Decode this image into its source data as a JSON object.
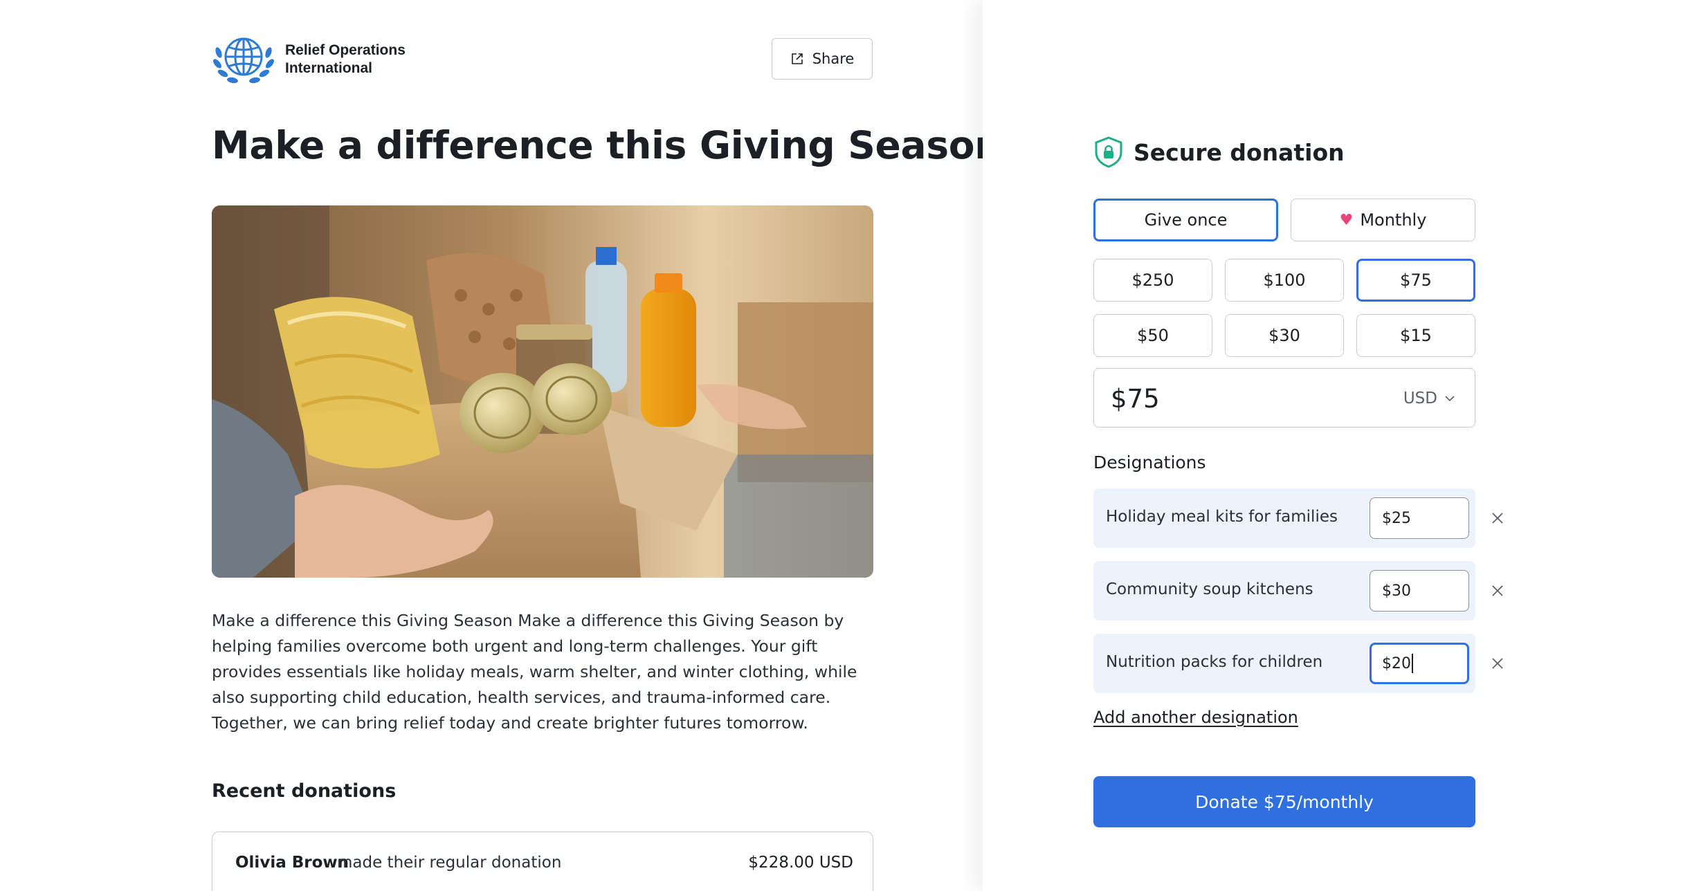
{
  "org": {
    "name_line1": "Relief Operations",
    "name_line2": "International",
    "logo_icon": "globe-laurel-icon"
  },
  "header": {
    "share_label": "Share",
    "share_icon": "share-icon"
  },
  "campaign": {
    "title": "Make a difference this Giving Season",
    "hero_image": "food-donation-box-photo",
    "description": "Make a difference this Giving Season Make a difference this Giving Season by helping families overcome both urgent and long-term challenges. Your gift provides essentials like holiday meals, warm shelter, and winter clothing, while also supporting child education, health services, and trauma-informed care. Together, we can bring relief today and create brighter futures tomorrow."
  },
  "recent": {
    "title": "Recent donations",
    "items": [
      {
        "name": "Olivia Brown",
        "action": "made their regular donation",
        "amount": "$228.00 USD"
      }
    ]
  },
  "donation": {
    "title": "Secure donation",
    "secure_icon": "shield-lock-icon",
    "frequency": {
      "once_label": "Give once",
      "monthly_label": "Monthly",
      "monthly_icon": "heart-icon",
      "selected": "once"
    },
    "amounts": [
      "$250",
      "$100",
      "$75",
      "$50",
      "$30",
      "$15"
    ],
    "selected_amount": "$75",
    "amount_value": "$75",
    "currency": "USD",
    "designations_label": "Designations",
    "designations": [
      {
        "name": "Holiday meal kits for families",
        "value": "$25"
      },
      {
        "name": "Community soup kitchens",
        "value": "$30"
      },
      {
        "name": "Nutrition packs for children",
        "value": "$20"
      }
    ],
    "add_designation_label": "Add another designation",
    "donate_label": "Donate $75/monthly"
  },
  "colors": {
    "accent": "#2f6fe0",
    "heart": "#e8457a",
    "secure_green": "#1fae86",
    "designation_bg": "#edf3fc",
    "logo_blue": "#2e7bd6"
  }
}
